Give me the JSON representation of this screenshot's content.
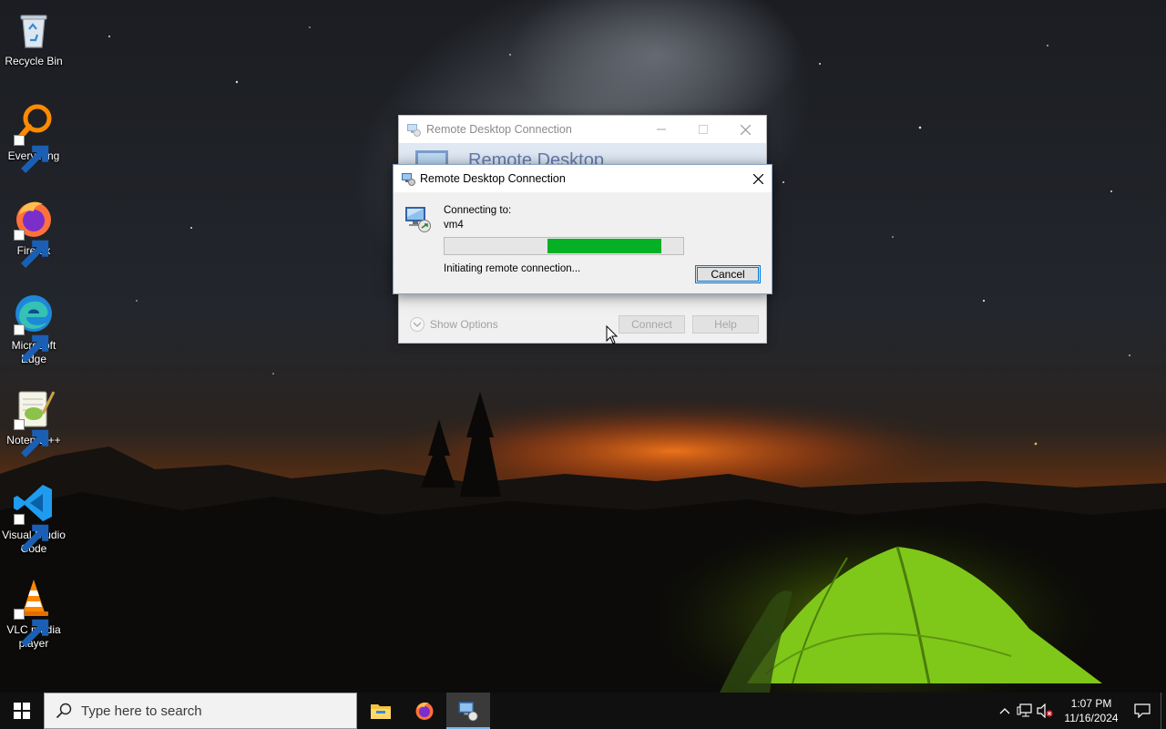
{
  "desktop": {
    "icons": [
      {
        "label": "Recycle Bin",
        "icon": "recycle-bin-icon"
      },
      {
        "label": "Everything",
        "icon": "everything-search-icon"
      },
      {
        "label": "Firefox",
        "icon": "firefox-icon"
      },
      {
        "label": "Microsoft Edge",
        "icon": "edge-icon"
      },
      {
        "label": "Notepad++",
        "icon": "notepadpp-icon"
      },
      {
        "label": "Visual Studio Code",
        "icon": "vscode-icon"
      },
      {
        "label": "VLC media player",
        "icon": "vlc-icon"
      }
    ]
  },
  "rdc_main": {
    "title": "Remote Desktop Connection",
    "banner_title": "Remote Desktop",
    "show_options_label": "Show Options",
    "connect_label": "Connect",
    "help_label": "Help"
  },
  "rdc_progress": {
    "title": "Remote Desktop Connection",
    "connecting_label": "Connecting to:",
    "host": "vm4",
    "progress_start": 0.43,
    "progress_end": 0.91,
    "status": "Initiating remote connection...",
    "cancel_label": "Cancel",
    "progress_color": "#06b025"
  },
  "taskbar": {
    "search_placeholder": "Type here to search",
    "apps": [
      "file-explorer-icon",
      "firefox-icon",
      "remote-desktop-icon"
    ],
    "active_app": "remote-desktop-icon",
    "time": "1:07 PM",
    "date": "11/16/2024",
    "accent": "#76b9ed"
  }
}
